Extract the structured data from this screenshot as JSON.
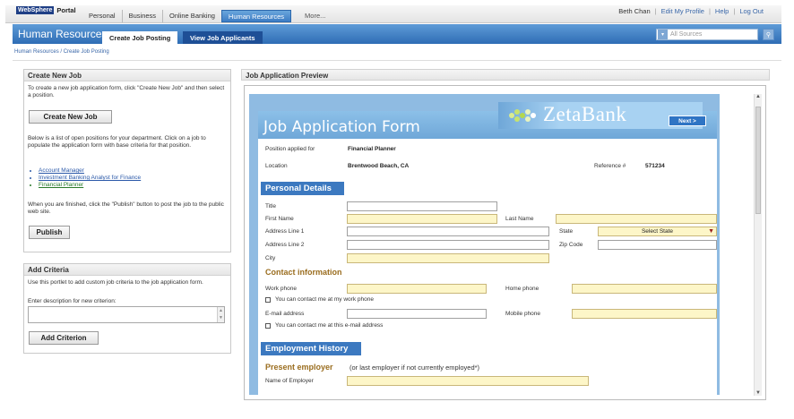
{
  "top": {
    "logo_ws": "WebSphere",
    "logo_portal": "Portal",
    "tabs": [
      {
        "label": "Personal"
      },
      {
        "label": "Business"
      },
      {
        "label": "Online Banking"
      },
      {
        "label": "Human Resources"
      }
    ],
    "more": "More...",
    "user": "Beth Chan",
    "edit_profile": "Edit My Profile",
    "help": "Help",
    "logout": "Log Out"
  },
  "hr": {
    "title": "Human Resources",
    "tab_create": "Create Job Posting",
    "tab_view": "View Job Applicants",
    "source_placeholder": "All Sources",
    "breadcrumb": "Human Resources / Create Job Posting"
  },
  "create_job": {
    "title": "Create New Job",
    "intro": "To create a new job application form, click \"Create New Job\" and then select a position.",
    "button": "Create New Job",
    "positions_text": "Below is a list of open positions for your department. Click on a job to populate the application form with base criteria for that position.",
    "positions": [
      "Account Manager",
      "Investment Banking Analyst for Finance",
      "Financial Planner"
    ],
    "publish_text": "When you are finished, click the \"Publish\" button to post the job to the public web site.",
    "publish_button": "Publish"
  },
  "add_criteria": {
    "title": "Add Criteria",
    "intro": "Use this portlet to add custom job criteria to the job application form.",
    "label": "Enter description for new criterion:",
    "button": "Add Criterion"
  },
  "preview": {
    "title": "Job Application Preview",
    "form_title": "Job Application Form",
    "brand": "ZetaBank",
    "next": "Next >",
    "position_label": "Position applied for",
    "position_value": "Financial Planner",
    "location_label": "Location",
    "location_value": "Brentwood Beach, CA",
    "reference_label": "Reference #",
    "reference_value": "571234",
    "personal_details": "Personal Details",
    "title_label": "Title",
    "first_name": "First Name",
    "last_name": "Last Name",
    "address1": "Address Line 1",
    "address2": "Address Line 2",
    "state": "State",
    "state_select": "Select State",
    "zip": "Zip Code",
    "city": "City",
    "contact_info": "Contact information",
    "work_phone": "Work phone",
    "home_phone": "Home phone",
    "work_contact_ok": "You can contact me at my work phone",
    "email": "E-mail address",
    "mobile_phone": "Mobile phone",
    "email_contact_ok": "You can contact me at this e-mail address",
    "employment_history": "Employment History",
    "present_employer": "Present employer",
    "present_employer_note": "(or last employer if not currently employed*)",
    "employer_name": "Name of Employer"
  }
}
